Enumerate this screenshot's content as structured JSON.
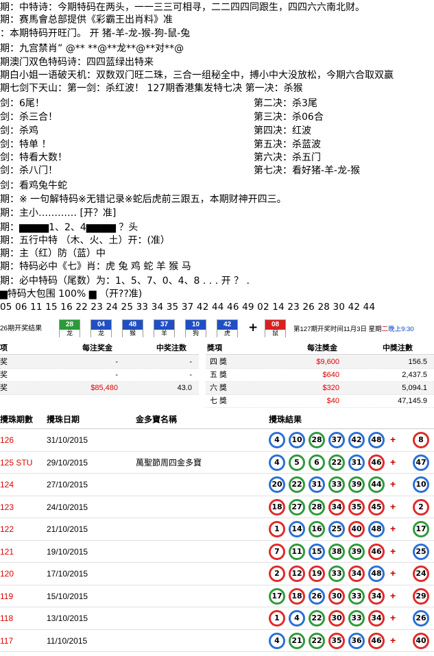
{
  "lines": [
    "期：中特诗：今期特码在两头，一一三三可相寻，二二四四同跟生，四四六六南北财。",
    "期：赛馬會总部提供《彩霸王出肖料》准",
    "：本期特码开旺门。        开 猪-羊-龙-猴-狗-鼠-兔",
    "期：九宫禁肖”  @** **@**龙**@**对**@",
    "期澳门双色特码诗：四四蓝绿出特来",
    "期白小姐一语破天机：双数双门旺二珠，三合一组秘全中，搏小中大没放松，今期六合取双赢",
    "期七剑下天山：第一剑：杀红波！      127期香港集发特七决 第一决：杀猴"
  ],
  "swords_left": [
    "剑：6尾！",
    "剑：杀三合！",
    "剑：杀鸡",
    "剑：特单 ！",
    "剑：特看大数！",
    "剑：杀八门！"
  ],
  "swords_right": [
    "第二决：杀3尾",
    "第三决：杀06合",
    "第四决：红波",
    "第五决：杀蓝波",
    "第六决：杀五门",
    "第七决：看好猪-羊-龙-猴"
  ],
  "lines2": [
    "剑：看鸡兔牛蛇",
    "期：※ 一句解特码※无错记录※蛇后虎前三跟五，本期财神开四三。",
    "期：主小………… [开？准]",
    "期：▆▆▆▆1、2、4▆▆▆▆ ？头",
    "期：五行中特  （木、火、土）开：(准）",
    "期：主（红）防（蓝）中",
    "期：特码必中《七》肖：虎 兔 鸡 蛇 羊 猴 马",
    "期：必中特码（尾数）为：1、5、7、0、4、8 . . . 开 ？ .",
    "▆特码大包围 100% ▆    （开??准)"
  ],
  "numbers_line": "05 06 11 15 16 22 23 24 25 33 34 35 37 42 44 46 49 02 14 23 26 28 30 42 44",
  "draw": {
    "label": "26期开奖结果",
    "balls": [
      {
        "num": "28",
        "zodiac": "龙",
        "color": "#2a9a3a"
      },
      {
        "num": "04",
        "zodiac": "龙",
        "color": "#1f4fc4"
      },
      {
        "num": "48",
        "zodiac": "猴",
        "color": "#1f4fc4"
      },
      {
        "num": "37",
        "zodiac": "羊",
        "color": "#1f4fc4"
      },
      {
        "num": "10",
        "zodiac": "狗",
        "color": "#1f4fc4"
      },
      {
        "num": "42",
        "zodiac": "虎",
        "color": "#1f4fc4"
      }
    ],
    "plus": "+",
    "special": {
      "num": "08",
      "zodiac": "鼠",
      "color": "#d82020"
    },
    "info_prefix": "第127期开奖时间11月3日 星期",
    "info_day": "二",
    "info_time": "晚上9:30"
  },
  "prize_left": {
    "headers": [
      "项",
      "每注奖金",
      "中奖注数"
    ],
    "rows": [
      {
        "name": "奖",
        "amount": "-",
        "count": "-"
      },
      {
        "name": "奖",
        "amount": "-",
        "count": "-"
      },
      {
        "name": "奖",
        "amount": "$85,480",
        "count": "43.0"
      }
    ]
  },
  "prize_right": {
    "headers": [
      "獎項",
      "每注獎金",
      "中獎注數"
    ],
    "rows": [
      {
        "name": "四 獎",
        "amount": "$9,600",
        "count": "156.5"
      },
      {
        "name": "五 獎",
        "amount": "$640",
        "count": "2,437.5"
      },
      {
        "name": "六 獎",
        "amount": "$320",
        "count": "5,094.1"
      },
      {
        "name": "七 獎",
        "amount": "$40",
        "count": "47,145.9"
      }
    ]
  },
  "history": {
    "headers": [
      "攪珠期數",
      "攪珠日期",
      "金多寶名稱",
      "攪珠結果"
    ],
    "rows": [
      {
        "issue": "126",
        "date": "31/10/2015",
        "name": "",
        "balls": [
          [
            "4",
            "blue"
          ],
          [
            "10",
            "blue"
          ],
          [
            "28",
            "green"
          ],
          [
            "37",
            "blue"
          ],
          [
            "42",
            "blue"
          ],
          [
            "48",
            "blue"
          ]
        ],
        "special": [
          "8",
          "red"
        ]
      },
      {
        "issue": "125 STU",
        "date": "29/10/2015",
        "name": "萬聖節周四金多寶",
        "balls": [
          [
            "4",
            "blue"
          ],
          [
            "5",
            "green"
          ],
          [
            "6",
            "green"
          ],
          [
            "22",
            "green"
          ],
          [
            "31",
            "blue"
          ],
          [
            "46",
            "red"
          ]
        ],
        "special": [
          "47",
          "blue"
        ]
      },
      {
        "issue": "124",
        "date": "27/10/2015",
        "name": "",
        "balls": [
          [
            "20",
            "blue"
          ],
          [
            "22",
            "green"
          ],
          [
            "31",
            "blue"
          ],
          [
            "33",
            "green"
          ],
          [
            "39",
            "green"
          ],
          [
            "44",
            "green"
          ]
        ],
        "special": [
          "10",
          "blue"
        ]
      },
      {
        "issue": "123",
        "date": "24/10/2015",
        "name": "",
        "balls": [
          [
            "18",
            "red"
          ],
          [
            "27",
            "green"
          ],
          [
            "28",
            "green"
          ],
          [
            "34",
            "red"
          ],
          [
            "35",
            "red"
          ],
          [
            "45",
            "red"
          ]
        ],
        "special": [
          "2",
          "red"
        ]
      },
      {
        "issue": "122",
        "date": "21/10/2015",
        "name": "",
        "balls": [
          [
            "1",
            "red"
          ],
          [
            "14",
            "blue"
          ],
          [
            "16",
            "green"
          ],
          [
            "25",
            "blue"
          ],
          [
            "40",
            "red"
          ],
          [
            "48",
            "blue"
          ]
        ],
        "special": [
          "17",
          "green"
        ]
      },
      {
        "issue": "121",
        "date": "19/10/2015",
        "name": "",
        "balls": [
          [
            "7",
            "red"
          ],
          [
            "11",
            "green"
          ],
          [
            "15",
            "blue"
          ],
          [
            "38",
            "green"
          ],
          [
            "39",
            "green"
          ],
          [
            "46",
            "red"
          ]
        ],
        "special": [
          "25",
          "blue"
        ]
      },
      {
        "issue": "120",
        "date": "17/10/2015",
        "name": "",
        "balls": [
          [
            "2",
            "red"
          ],
          [
            "12",
            "red"
          ],
          [
            "19",
            "red"
          ],
          [
            "33",
            "green"
          ],
          [
            "34",
            "red"
          ],
          [
            "48",
            "blue"
          ]
        ],
        "special": [
          "24",
          "red"
        ]
      },
      {
        "issue": "119",
        "date": "15/10/2015",
        "name": "",
        "balls": [
          [
            "17",
            "green"
          ],
          [
            "18",
            "red"
          ],
          [
            "26",
            "blue"
          ],
          [
            "30",
            "red"
          ],
          [
            "33",
            "green"
          ],
          [
            "34",
            "red"
          ]
        ],
        "special": [
          "29",
          "red"
        ]
      },
      {
        "issue": "118",
        "date": "13/10/2015",
        "name": "",
        "balls": [
          [
            "1",
            "red"
          ],
          [
            "4",
            "blue"
          ],
          [
            "22",
            "green"
          ],
          [
            "30",
            "red"
          ],
          [
            "33",
            "green"
          ],
          [
            "34",
            "red"
          ]
        ],
        "special": [
          "26",
          "blue"
        ]
      },
      {
        "issue": "117",
        "date": "11/10/2015",
        "name": "",
        "balls": [
          [
            "4",
            "blue"
          ],
          [
            "21",
            "green"
          ],
          [
            "22",
            "green"
          ],
          [
            "35",
            "red"
          ],
          [
            "36",
            "blue"
          ],
          [
            "46",
            "red"
          ]
        ],
        "special": [
          "40",
          "red"
        ]
      }
    ]
  }
}
